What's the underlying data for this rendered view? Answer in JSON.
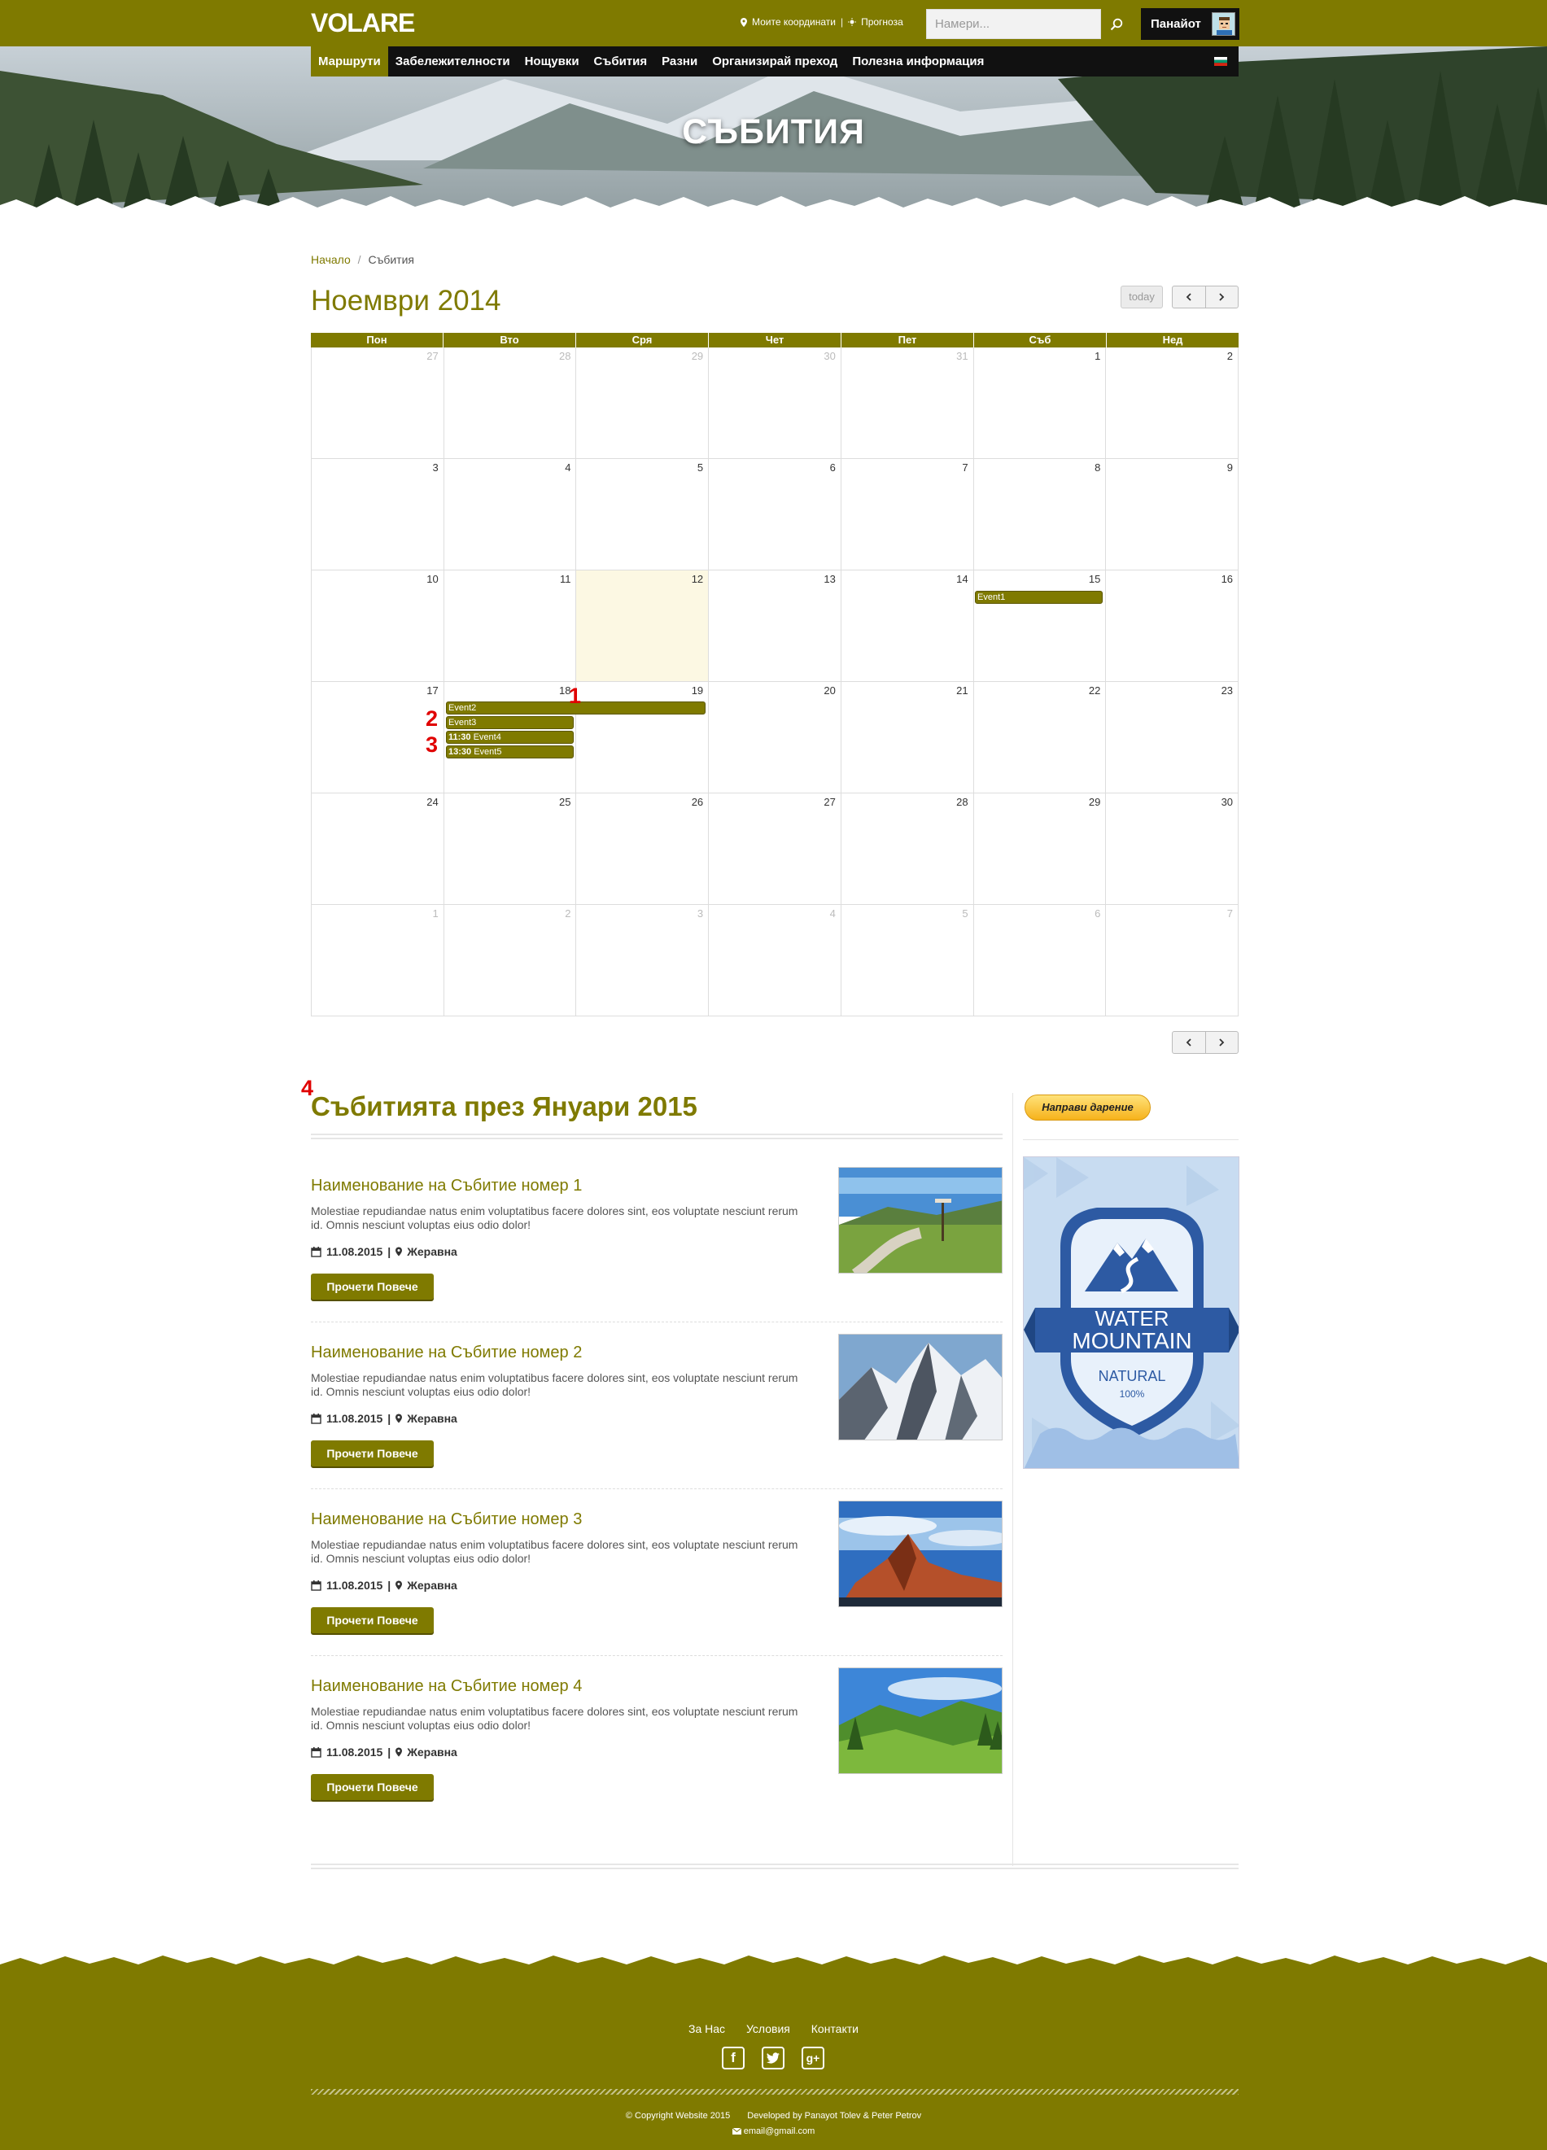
{
  "header": {
    "logo": "VOLARE",
    "coords_link": "Моите координати",
    "separator": "|",
    "forecast_link": "Прогноза",
    "search_placeholder": "Намери...",
    "user_name": "Панайот"
  },
  "nav": {
    "items": [
      {
        "label": "Маршрути",
        "active": true
      },
      {
        "label": "Забележителности",
        "active": false
      },
      {
        "label": "Нощувки",
        "active": false
      },
      {
        "label": "Събития",
        "active": false
      },
      {
        "label": "Разни",
        "active": false
      },
      {
        "label": "Организирай преход",
        "active": false
      },
      {
        "label": "Полезна информация",
        "active": false
      }
    ],
    "language_flag": "bg-flag-icon"
  },
  "hero": {
    "title": "СЪБИТИЯ"
  },
  "breadcrumb": {
    "home": "Начало",
    "divider": "/",
    "current": "Събития"
  },
  "calendar": {
    "title": "Ноември 2014",
    "today_label": "today",
    "weekdays": [
      "Пон",
      "Вто",
      "Сря",
      "Чет",
      "Пет",
      "Съб",
      "Нед"
    ],
    "weeks": [
      [
        {
          "d": "27",
          "other": true
        },
        {
          "d": "28",
          "other": true
        },
        {
          "d": "29",
          "other": true
        },
        {
          "d": "30",
          "other": true
        },
        {
          "d": "31",
          "other": true
        },
        {
          "d": "1"
        },
        {
          "d": "2"
        }
      ],
      [
        {
          "d": "3"
        },
        {
          "d": "4"
        },
        {
          "d": "5"
        },
        {
          "d": "6"
        },
        {
          "d": "7"
        },
        {
          "d": "8"
        },
        {
          "d": "9"
        }
      ],
      [
        {
          "d": "10"
        },
        {
          "d": "11"
        },
        {
          "d": "12",
          "today": true
        },
        {
          "d": "13"
        },
        {
          "d": "14"
        },
        {
          "d": "15"
        },
        {
          "d": "16"
        }
      ],
      [
        {
          "d": "17"
        },
        {
          "d": "18"
        },
        {
          "d": "19"
        },
        {
          "d": "20"
        },
        {
          "d": "21"
        },
        {
          "d": "22"
        },
        {
          "d": "23"
        }
      ],
      [
        {
          "d": "24"
        },
        {
          "d": "25"
        },
        {
          "d": "26"
        },
        {
          "d": "27"
        },
        {
          "d": "28"
        },
        {
          "d": "29"
        },
        {
          "d": "30"
        }
      ],
      [
        {
          "d": "1",
          "other": true
        },
        {
          "d": "2",
          "other": true
        },
        {
          "d": "3",
          "other": true
        },
        {
          "d": "4",
          "other": true
        },
        {
          "d": "5",
          "other": true
        },
        {
          "d": "6",
          "other": true
        },
        {
          "d": "7",
          "other": true
        }
      ]
    ],
    "events": [
      {
        "title": "Event1",
        "time": ""
      },
      {
        "title": "Event2",
        "time": ""
      },
      {
        "title": "Event3",
        "time": ""
      },
      {
        "title": "Event4",
        "time": "11:30"
      },
      {
        "title": "Event5",
        "time": "13:30"
      }
    ],
    "markers": [
      "1",
      "2",
      "3",
      "4"
    ]
  },
  "events_section": {
    "title": "Събитията през Януари 2015",
    "items": [
      {
        "title": "Наименование на Събитие номер 1",
        "description": "Molestiae repudiandae natus enim voluptatibus facere dolores sint, eos voluptate nesciunt rerum id. Omnis nesciunt voluptas eius odio dolor!",
        "date": "11.08.2015",
        "sep": "|",
        "location": "Жеравна",
        "button": "Прочети Повече"
      },
      {
        "title": "Наименование на Събитие номер 2",
        "description": "Molestiae repudiandae natus enim voluptatibus facere dolores sint, eos voluptate nesciunt rerum id. Omnis nesciunt voluptas eius odio dolor!",
        "date": "11.08.2015",
        "sep": "|",
        "location": "Жеравна",
        "button": "Прочети Повече"
      },
      {
        "title": "Наименование на Събитие номер 3",
        "description": "Molestiae repudiandae natus enim voluptatibus facere dolores sint, eos voluptate nesciunt rerum id. Omnis nesciunt voluptas eius odio dolor!",
        "date": "11.08.2015",
        "sep": "|",
        "location": "Жеравна",
        "button": "Прочети Повече"
      },
      {
        "title": "Наименование на Събитие номер 4",
        "description": "Molestiae repudiandae natus enim voluptatibus facere dolores sint, eos voluptate nesciunt rerum id. Omnis nesciunt voluptas eius odio dolor!",
        "date": "11.08.2015",
        "sep": "|",
        "location": "Жеравна",
        "button": "Прочети Повече"
      }
    ]
  },
  "sidebar": {
    "donate_button": "Направи дарение",
    "ad": {
      "line1": "WATER",
      "line2": "MOUNTAIN",
      "line3": "NATURAL",
      "line4": "100%"
    }
  },
  "footer": {
    "links": [
      "За Нас",
      "Условия",
      "Контакти"
    ],
    "social": [
      "facebook-icon",
      "twitter-icon",
      "google-plus-icon"
    ],
    "copyright": "© Copyright Website 2015",
    "developed": "Developed by Panayot Tolev & Peter Petrov",
    "email": "email@gmail.com"
  },
  "colors": {
    "brand": "#7f7a00",
    "nav_bg": "#111111",
    "today_bg": "#fcf8e3",
    "marker": "#e00000"
  }
}
